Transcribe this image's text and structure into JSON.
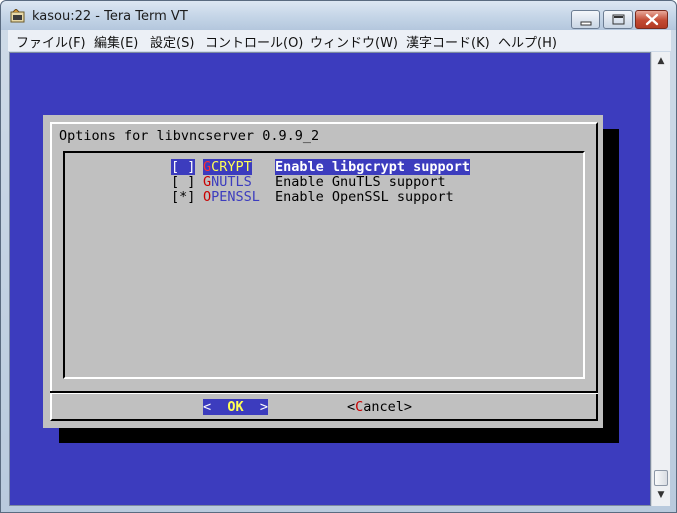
{
  "window": {
    "title": "kasou:22 - Tera Term VT"
  },
  "menu": {
    "items": [
      {
        "label": "ファイル(F)"
      },
      {
        "label": "編集(E)"
      },
      {
        "label": "設定(S)"
      },
      {
        "label": "コントロール(O)"
      },
      {
        "label": "ウィンドウ(W)"
      },
      {
        "label": "漢字コード(K)"
      },
      {
        "label": "ヘルプ(H)"
      }
    ]
  },
  "dialog": {
    "title": "Options for libvncserver 0.9.9_2",
    "options": [
      {
        "check": "[ ]",
        "hotkey": "G",
        "rest": "CRYPT",
        "description": "Enable libgcrypt support",
        "selected": true,
        "checked": false
      },
      {
        "check": "[ ]",
        "hotkey": "G",
        "rest": "NUTLS",
        "description": "Enable GnuTLS support",
        "selected": false,
        "checked": false
      },
      {
        "check": "[*]",
        "hotkey": "O",
        "rest": "PENSSL",
        "description": "Enable OpenSSL support",
        "selected": false,
        "checked": true
      }
    ],
    "ok": {
      "left": "<  ",
      "hotkey": "OK",
      "right": "  >"
    },
    "cancel": {
      "left": "<",
      "hotkey": "C",
      "right": "ancel>"
    }
  },
  "colors": {
    "terminal_bg": "#3c3cbe",
    "dialog_bg": "#c0c0c0",
    "hotkey_red": "#c80000",
    "highlight_yellow": "#ffff54"
  }
}
